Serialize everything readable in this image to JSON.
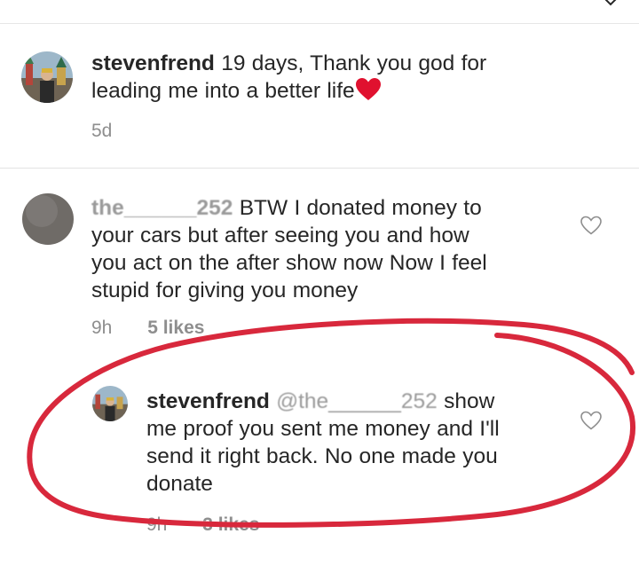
{
  "comments": [
    {
      "username": "stevenfrend",
      "text_line1": "19 days, Thank you god for",
      "text_line2": "leading me into a better life",
      "emoji": "red-heart",
      "time": "5d"
    },
    {
      "username": "the______252",
      "text_line1": "BTW I donated money to",
      "text_line2": "your cars but after seeing you and how",
      "text_line3": "you act on the after show now Now I feel",
      "text_line4": "stupid for giving you money",
      "time": "9h",
      "likes": "5 likes"
    },
    {
      "username": "stevenfrend",
      "mention": "@the______252",
      "text_line1": "show",
      "text_line2": "me proof you sent me money and I'll",
      "text_line3": "send it right back. No one made you",
      "text_line4": "donate",
      "time": "9h",
      "likes": "3 likes"
    }
  ],
  "colors": {
    "text": "#262626",
    "muted": "#8e8e8e",
    "annotation": "#d8283c",
    "heart_emoji": "#e0112f"
  },
  "icons": [
    "chevron-down-icon",
    "heart-outline-icon",
    "red-heart-emoji"
  ]
}
